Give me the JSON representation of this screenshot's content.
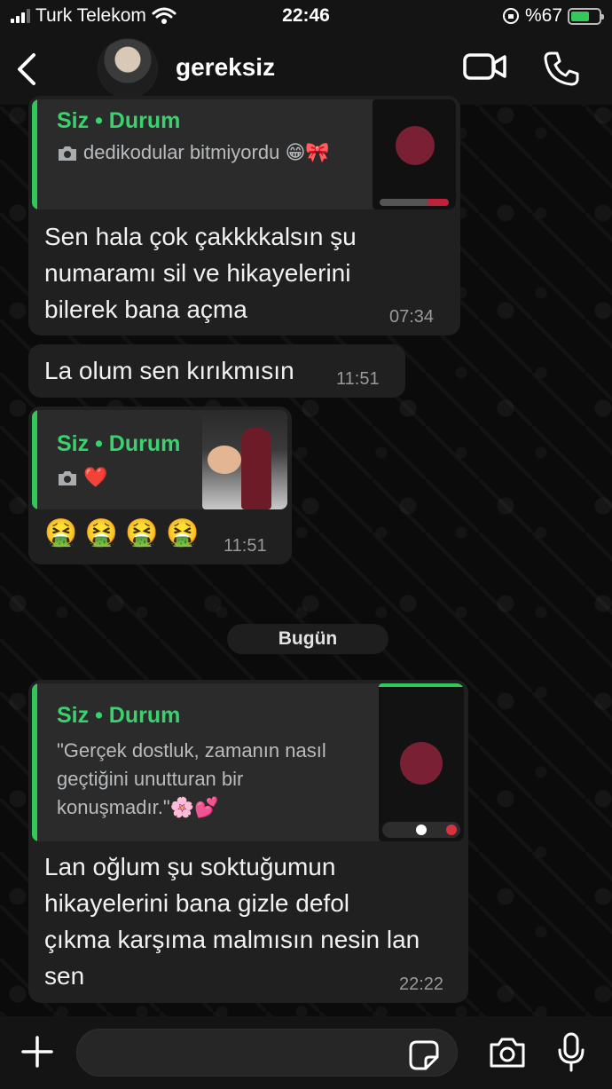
{
  "status_bar": {
    "carrier": "Turk Telekom",
    "time": "22:46",
    "battery_percent": "%67",
    "battery_level": 0.67
  },
  "header": {
    "back_icon": "chevron-left-icon",
    "contact_name": "gereksiz",
    "video_icon": "video-camera-icon",
    "call_icon": "phone-icon"
  },
  "messages": [
    {
      "quote_title": "Siz • Durum",
      "quote_text": "dedikodular bitmiyordu 😁🎀",
      "text_lines": [
        "Sen hala çok çakkkkalsın şu",
        "numaramı sil ve hikayelerini",
        "bilerek bana açma"
      ],
      "time": "07:34"
    },
    {
      "text": "La olum sen kırıkmısın",
      "time": "11:51"
    },
    {
      "quote_title": "Siz • Durum",
      "quote_text": "❤️",
      "text": "🤮 🤮 🤮 🤮",
      "time": "11:51"
    },
    {
      "quote_title": "Siz • Durum",
      "quote_text_lines": [
        "\"Gerçek dostluk, zamanın nasıl",
        "geçtiğini unutturan bir",
        "konuşmadır.\"🌸💕"
      ],
      "text_lines": [
        "Lan oğlum şu soktuğumun",
        "hikayelerini bana gizle defol",
        "çıkma karşıma malmısın nesin lan",
        "sen"
      ],
      "time": "22:22"
    }
  ],
  "date_separator": "Bugün",
  "input_bar": {
    "placeholder": "",
    "plus_icon": "plus-icon",
    "sticker_icon": "sticker-icon",
    "camera_icon": "camera-icon",
    "mic_icon": "microphone-icon"
  },
  "colors": {
    "accent": "#31c75a",
    "bubble": "#202020",
    "quote_bg": "#2b2b2b",
    "background": "#0b0b0b"
  }
}
